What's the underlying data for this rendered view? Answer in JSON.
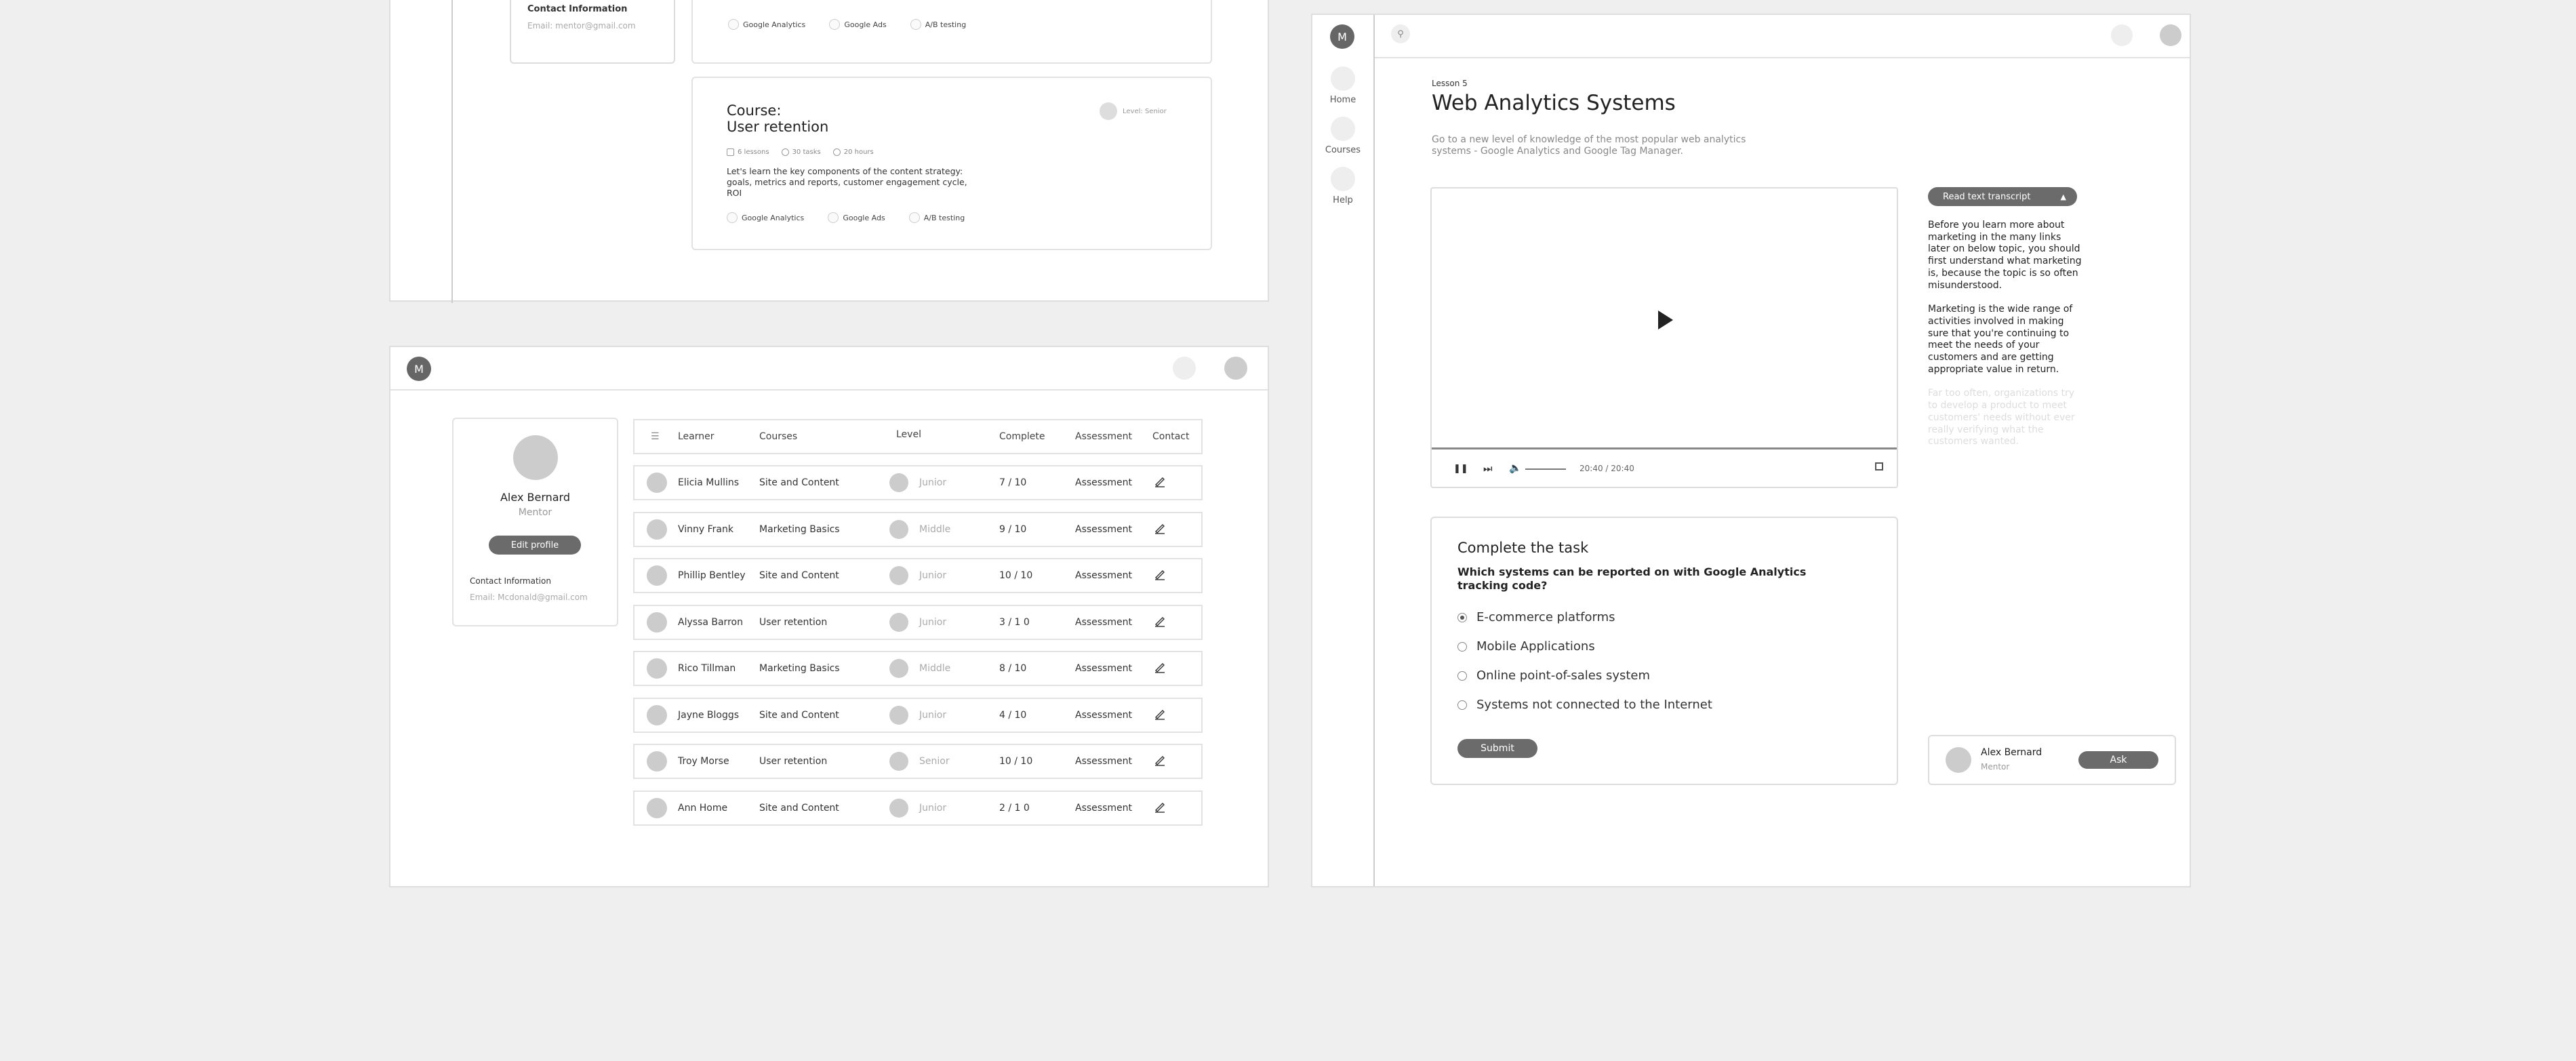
{
  "frame1": {
    "contact_title": "Contact Information",
    "contact_email": "Email: mentor@gmail.com",
    "top_tags": [
      "Google Analytics",
      "Google Ads",
      "A/B testing"
    ],
    "course": {
      "prefix": "Course:",
      "title": "User retention",
      "level": "Level: Senior",
      "meta": [
        "6 lessons",
        "30 tasks",
        "20 hours"
      ],
      "description": "Let's learn the key components of the content strategy: goals, metrics and reports, customer engagement cycle, ROI",
      "tags": [
        "Google Analytics",
        "Google Ads",
        "A/B testing"
      ]
    }
  },
  "frame2": {
    "logo": "M",
    "profile": {
      "name": "Alex Bernard",
      "role": "Mentor",
      "edit_label": "Edit profile",
      "contact_title": "Contact Information",
      "contact_email": "Email: Mcdonald@gmail.com"
    },
    "table": {
      "headers": [
        "Learner",
        "Courses",
        "Level",
        "Complete",
        "Assessment",
        "Contact"
      ],
      "rows": [
        {
          "learner": "Elicia Mullins",
          "course": "Site and Content",
          "level": "Junior",
          "complete": "7 / 10",
          "assessment": "Assessment"
        },
        {
          "learner": "Vinny Frank",
          "course": "Marketing Basics",
          "level": "Middle",
          "complete": "9 / 10",
          "assessment": "Assessment"
        },
        {
          "learner": "Phillip Bentley",
          "course": "Site and Content",
          "level": "Junior",
          "complete": "10 / 10",
          "assessment": "Assessment"
        },
        {
          "learner": "Alyssa Barron",
          "course": "User retention",
          "level": "Junior",
          "complete": "3 / 1 0",
          "assessment": "Assessment"
        },
        {
          "learner": "Rico Tillman",
          "course": "Marketing Basics",
          "level": "Middle",
          "complete": "8 / 10",
          "assessment": "Assessment"
        },
        {
          "learner": "Jayne Bloggs",
          "course": "Site and Content",
          "level": "Junior",
          "complete": "4 / 10",
          "assessment": "Assessment"
        },
        {
          "learner": "Troy Morse",
          "course": "User retention",
          "level": "Senior",
          "complete": "10 / 10",
          "assessment": "Assessment"
        },
        {
          "learner": "Ann Home",
          "course": "Site and Content",
          "level": "Junior",
          "complete": "2 / 1 0",
          "assessment": "Assessment"
        }
      ]
    }
  },
  "frame3": {
    "logo": "M",
    "nav": [
      {
        "label": "Home",
        "icon": "home-icon"
      },
      {
        "label": "Courses",
        "icon": "courses-icon"
      },
      {
        "label": "Help",
        "icon": "help-icon"
      }
    ],
    "lesson_label": "Lesson 5",
    "lesson_title": "Web Analytics Systems",
    "lesson_desc": "Go to a new level of knowledge of the most popular web analytics systems - Google Analytics and Google Tag Manager.",
    "video": {
      "time": "20:40 / 20:40",
      "progress": 1.0
    },
    "transcript": {
      "button_label": "Read text transcript",
      "p1": "Before you learn more about marketing in the many links later on below topic, you should first understand what marketing is, because the topic is so often misunderstood.",
      "p2": "Marketing is the wide range of activities involved in making sure that you're continuing to meet the needs of your customers and are getting appropriate value in return.",
      "p3": "Far too often, organizations try to develop a product to meet customers' needs without ever really verifying what the customers wanted."
    },
    "task": {
      "title": "Complete the task",
      "question": "Which systems can be reported on with Google Analytics tracking code?",
      "options": [
        "E-commerce platforms",
        "Mobile Applications",
        "Online point-of-sales system",
        "Systems not connected to the Internet"
      ],
      "selected_index": 0,
      "submit_label": "Submit"
    },
    "mentor": {
      "name": "Alex Bernard",
      "role": "Mentor",
      "ask_label": "Ask"
    }
  }
}
